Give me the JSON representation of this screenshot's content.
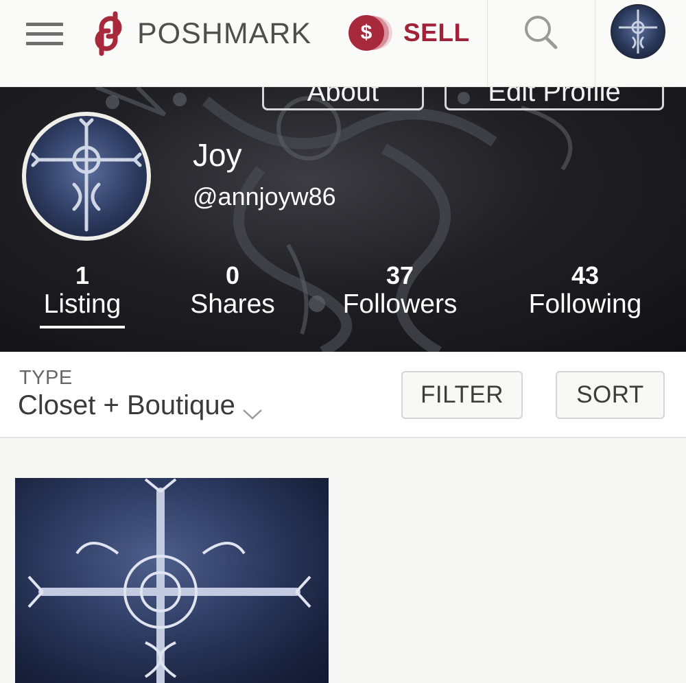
{
  "header": {
    "brand_name": "POSHMARK",
    "sell_symbol": "$",
    "sell_label": "SELL",
    "brand_color": "#a8283c",
    "icons": [
      "menu-icon",
      "poshmark-logo-icon",
      "search-icon",
      "user-avatar"
    ]
  },
  "cover": {
    "about_label": "About",
    "edit_profile_label": "Edit Profile"
  },
  "profile": {
    "name": "Joy",
    "handle": "@annjoyw86"
  },
  "stats": [
    {
      "count": "1",
      "label": "Listing"
    },
    {
      "count": "0",
      "label": "Shares"
    },
    {
      "count": "37",
      "label": "Followers"
    },
    {
      "count": "43",
      "label": "Following"
    }
  ],
  "filters": {
    "type_label": "TYPE",
    "type_value": "Closet + Boutique",
    "filter_label": "FILTER",
    "sort_label": "SORT"
  }
}
